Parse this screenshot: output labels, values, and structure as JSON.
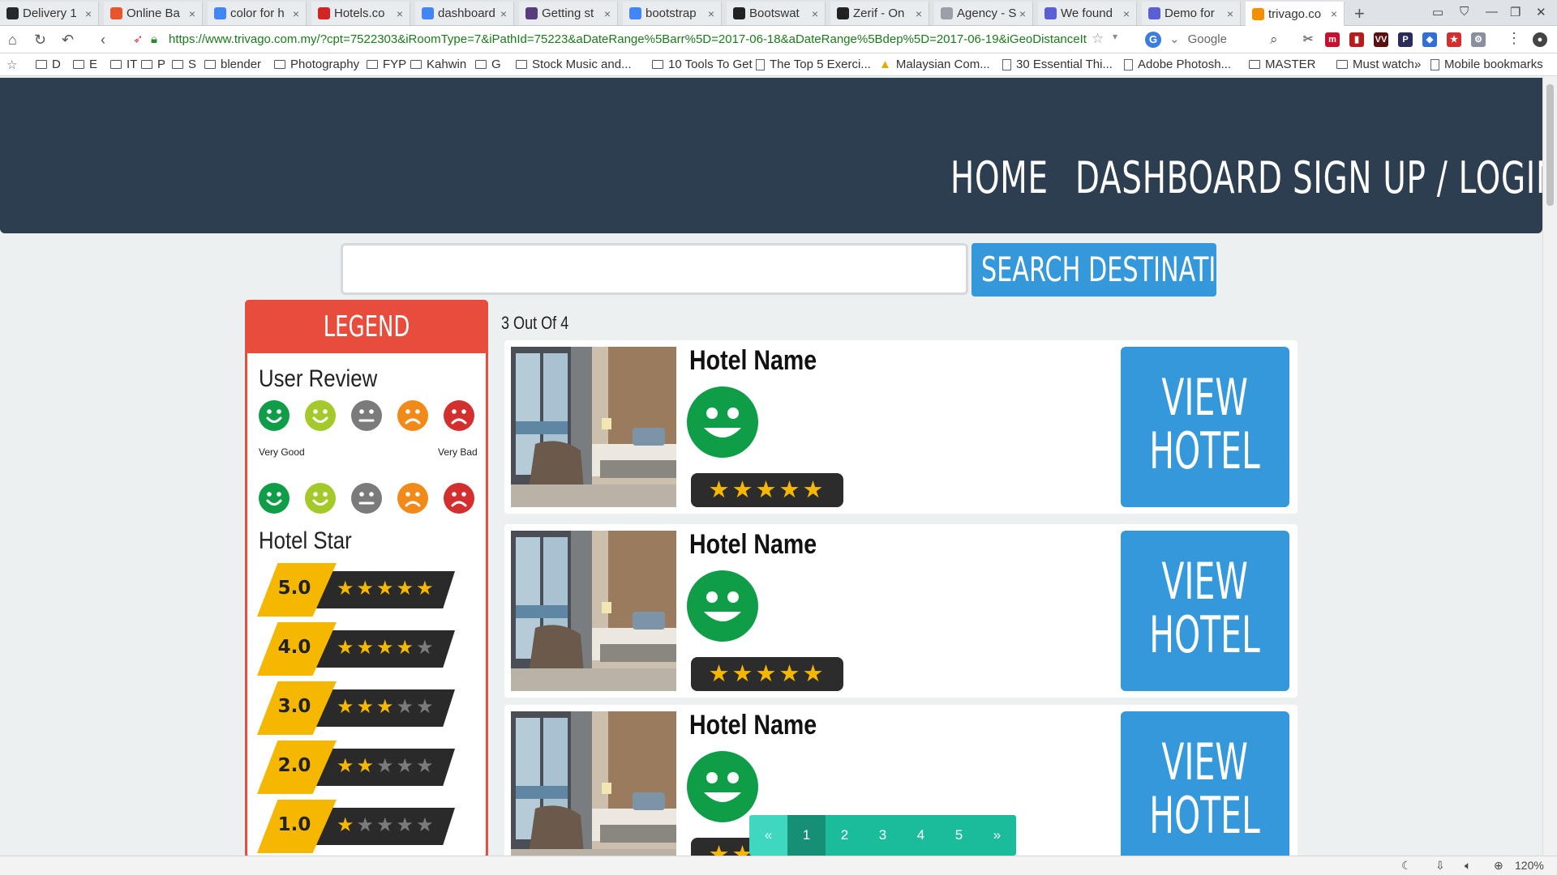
{
  "browser": {
    "tabs": [
      {
        "label": "Delivery 1",
        "icon": "github-icon",
        "color": "#24292e"
      },
      {
        "label": "Online Ba",
        "icon": "store-icon",
        "color": "#e8552d"
      },
      {
        "label": "color for h",
        "icon": "google-icon",
        "color": "#4285f4"
      },
      {
        "label": "Hotels.co",
        "icon": "hotels-icon",
        "color": "#d32323"
      },
      {
        "label": "dashboard",
        "icon": "google-icon",
        "color": "#4285f4"
      },
      {
        "label": "Getting st",
        "icon": "bootstrap-icon",
        "color": "#563d7c"
      },
      {
        "label": "bootstrap",
        "icon": "google-icon",
        "color": "#4285f4"
      },
      {
        "label": "Bootswat",
        "icon": "bootswatch-icon",
        "color": "#222222"
      },
      {
        "label": "Zerif - On",
        "icon": "wordpress-icon",
        "color": "#222222"
      },
      {
        "label": "Agency - S",
        "icon": "page-icon",
        "color": "#9aa0a6"
      },
      {
        "label": "We found",
        "icon": "shield-icon",
        "color": "#5b5fd6"
      },
      {
        "label": "Demo for",
        "icon": "shield-icon",
        "color": "#5b5fd6"
      },
      {
        "label": "trivago.co",
        "icon": "trivago-icon",
        "color": "#f48f00"
      }
    ],
    "url": "https://www.trivago.com.my/?cpt=7522303&iRoomType=7&iPathId=75223&aDateRange%5Barr%5D=2017-06-18&aDateRange%5Bdep%5D=2017-06-19&iGeoDistanceIt",
    "search_engine": "Google",
    "bookmarks": [
      {
        "label": "D",
        "type": "folder"
      },
      {
        "label": "E",
        "type": "folder"
      },
      {
        "label": "IT",
        "type": "folder"
      },
      {
        "label": "P",
        "type": "folder"
      },
      {
        "label": "S",
        "type": "folder"
      },
      {
        "label": "blender",
        "type": "folder"
      },
      {
        "label": "Photography",
        "type": "folder"
      },
      {
        "label": "FYP",
        "type": "folder"
      },
      {
        "label": "Kahwin",
        "type": "folder"
      },
      {
        "label": "G",
        "type": "folder"
      },
      {
        "label": "Stock Music and...",
        "type": "folder"
      },
      {
        "label": "10 Tools To Get ...",
        "type": "folder"
      },
      {
        "label": "The Top 5 Exerci...",
        "type": "page"
      },
      {
        "label": "Malaysian Com...",
        "type": "drive"
      },
      {
        "label": "30 Essential Thi...",
        "type": "page"
      },
      {
        "label": "Adobe Photosh...",
        "type": "page"
      },
      {
        "label": "MASTER",
        "type": "folder"
      },
      {
        "label": "Must watch.",
        "type": "folder"
      },
      {
        "label": "»",
        "type": "chevron"
      },
      {
        "label": "Mobile bookmarks",
        "type": "page"
      }
    ],
    "zoom": "120%"
  },
  "site": {
    "nav": [
      "HOME",
      "DASHBOARD",
      "SIGN UP / LOGIN"
    ],
    "search_placeholder": "",
    "search_button": "SEARCH DESTINATION",
    "legend": {
      "title": "LEGEND",
      "user_review_title": "User Review",
      "faces": [
        {
          "name": "very-good-face-icon",
          "color": "#0f9d48",
          "mood": "happy"
        },
        {
          "name": "good-face-icon",
          "color": "#a4c92a",
          "mood": "happy"
        },
        {
          "name": "neutral-face-icon",
          "color": "#7b7b7b",
          "mood": "neutral"
        },
        {
          "name": "bad-face-icon",
          "color": "#f28a1a",
          "mood": "sad"
        },
        {
          "name": "very-bad-face-icon",
          "color": "#d32f2f",
          "mood": "sad"
        }
      ],
      "very_good": "Very Good",
      "very_bad": "Very Bad",
      "hotel_star_title": "Hotel Star",
      "star_levels": [
        {
          "label": "5.0",
          "stars": 5
        },
        {
          "label": "4.0",
          "stars": 4
        },
        {
          "label": "3.0",
          "stars": 3
        },
        {
          "label": "2.0",
          "stars": 2
        },
        {
          "label": "1.0",
          "stars": 1
        }
      ]
    },
    "result_count": "3 Out Of 4",
    "hotels": [
      {
        "name": "Hotel Name",
        "stars": 5,
        "review": "very-good",
        "button": [
          "VIEW",
          "HOTEL"
        ]
      },
      {
        "name": "Hotel Name",
        "stars": 5,
        "review": "very-good",
        "button": [
          "VIEW",
          "HOTEL"
        ]
      },
      {
        "name": "Hotel Name",
        "stars": 5,
        "review": "very-good",
        "button": [
          "VIEW",
          "HOTEL"
        ]
      }
    ],
    "pagination": [
      "«",
      "1",
      "2",
      "3",
      "4",
      "5",
      "»"
    ],
    "pagination_active": "1",
    "colors": {
      "header": "#2c3e50",
      "accent_blue": "#3498db",
      "legend_red": "#e74c3c",
      "pagination_teal": "#1abc9c",
      "star_gold": "#f5b700"
    }
  }
}
